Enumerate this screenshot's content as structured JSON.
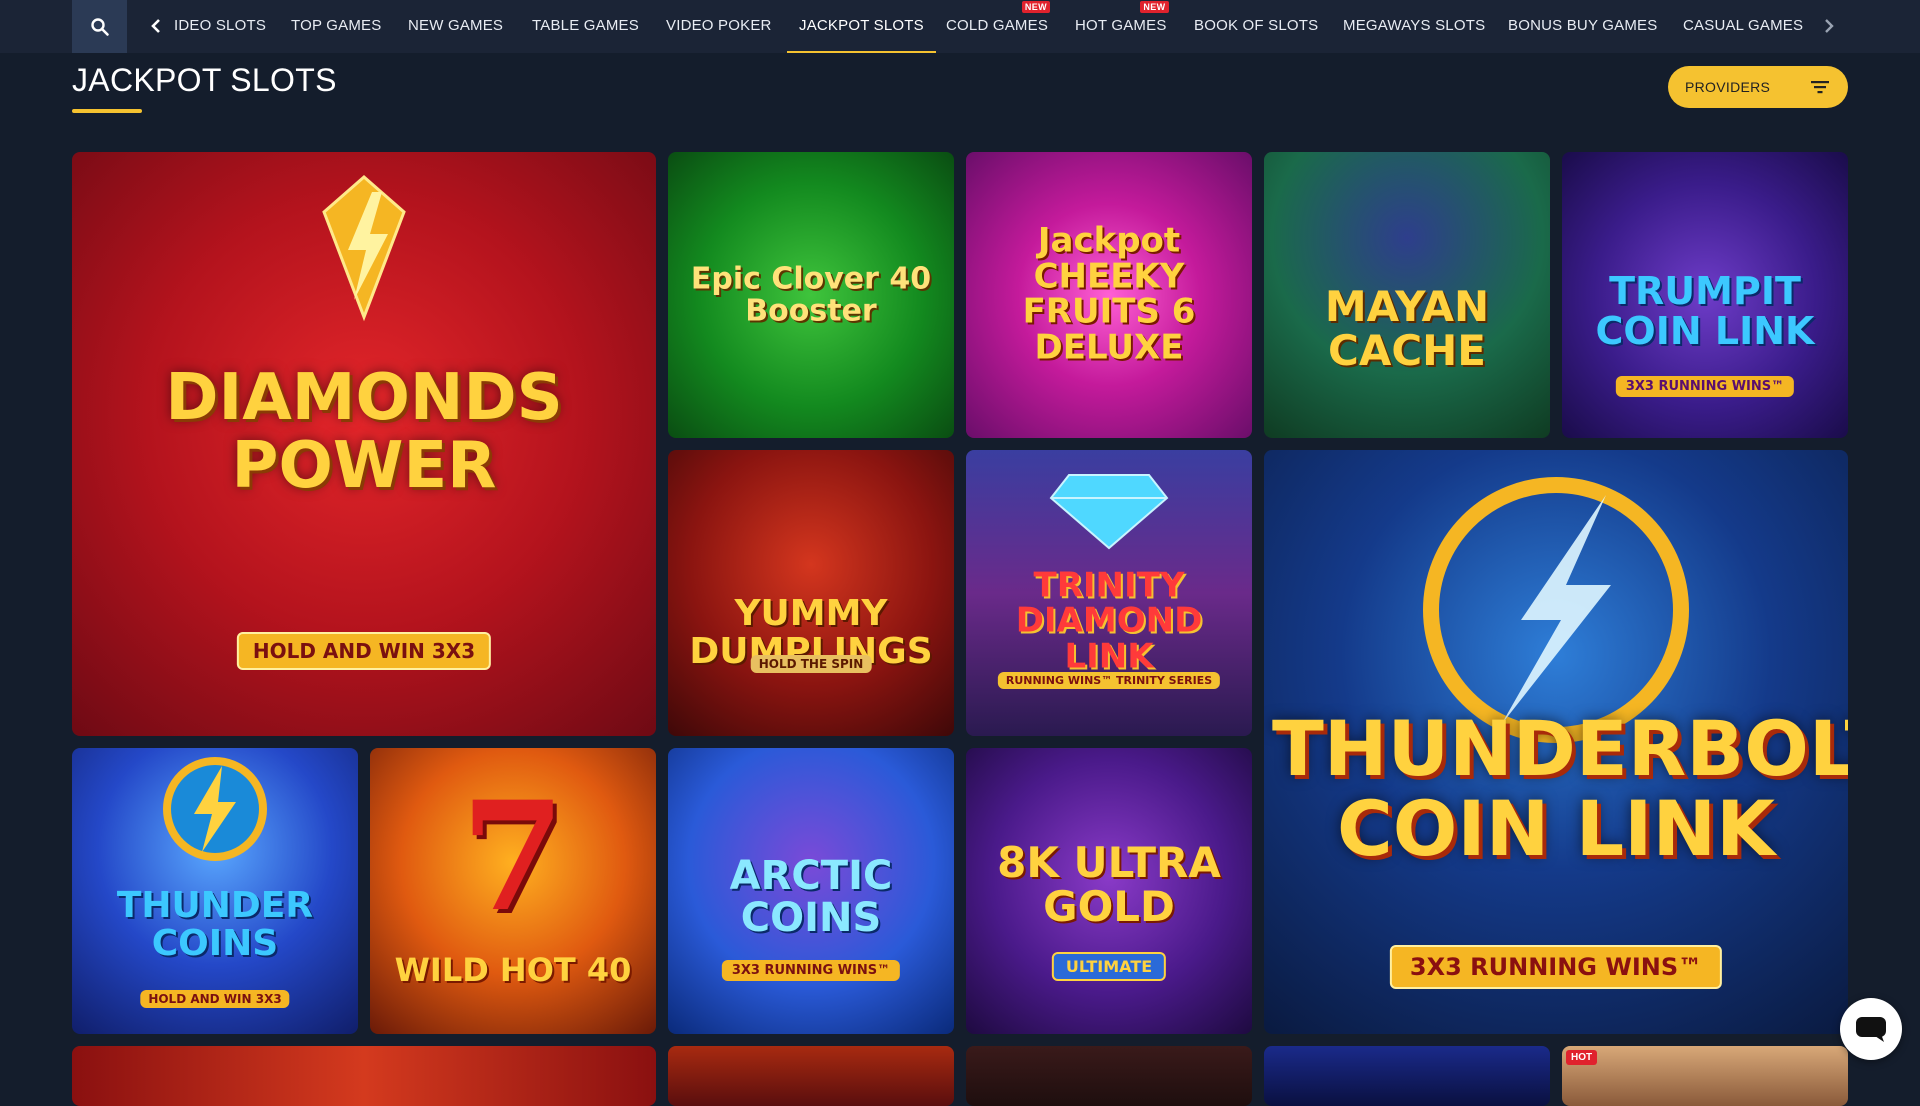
{
  "nav": {
    "items": [
      {
        "label": "IDEO SLOTS"
      },
      {
        "label": "TOP GAMES"
      },
      {
        "label": "NEW GAMES"
      },
      {
        "label": "TABLE GAMES"
      },
      {
        "label": "VIDEO POKER"
      },
      {
        "label": "JACKPOT SLOTS",
        "active": true
      },
      {
        "label": "COLD GAMES",
        "badge": "NEW"
      },
      {
        "label": "HOT GAMES",
        "badge": "NEW"
      },
      {
        "label": "BOOK OF SLOTS"
      },
      {
        "label": "MEGAWAYS SLOTS"
      },
      {
        "label": "BONUS BUY GAMES"
      },
      {
        "label": "CASUAL GAMES"
      }
    ]
  },
  "page": {
    "title": "JACKPOT SLOTS",
    "providers_label": "PROVIDERS"
  },
  "games": [
    {
      "title": "DIAMONDS POWER",
      "subtitle": "HOLD AND WIN 3X3"
    },
    {
      "title": "Epic Clover 40 Booster",
      "subtitle": ""
    },
    {
      "title": "Jackpot CHEEKY FRUITS 6 DELUXE",
      "subtitle": ""
    },
    {
      "title": "MAYAN CACHE",
      "subtitle": ""
    },
    {
      "title": "TRUMPIT COIN LINK",
      "subtitle": "3X3 RUNNING WINS™"
    },
    {
      "title": "YUMMY DUMPLINGS",
      "subtitle": "HOLD THE SPIN"
    },
    {
      "title": "TRINITY DIAMOND LINK",
      "subtitle": "RUNNING WINS™ TRINITY SERIES"
    },
    {
      "title": "THUNDERBOLT COIN LINK",
      "subtitle": "3X3 RUNNING WINS™"
    },
    {
      "title": "THUNDER COINS",
      "subtitle": "HOLD AND WIN 3X3"
    },
    {
      "title": "WILD HOT 40",
      "subtitle": ""
    },
    {
      "title": "ARCTIC COINS",
      "subtitle": "3X3 RUNNING WINS™"
    },
    {
      "title": "8K ULTRA GOLD",
      "subtitle": "ULTIMATE"
    }
  ],
  "hot_badge": "HOT",
  "colors": {
    "background": "#141d2c",
    "nav_background": "#1b2436",
    "accent": "#f5c230",
    "badge_red": "#e0222d"
  },
  "icons": {
    "search": "search-icon",
    "prev": "chevron-left-icon",
    "next": "chevron-right-icon",
    "filter": "filter-icon",
    "chat": "chat-icon"
  }
}
